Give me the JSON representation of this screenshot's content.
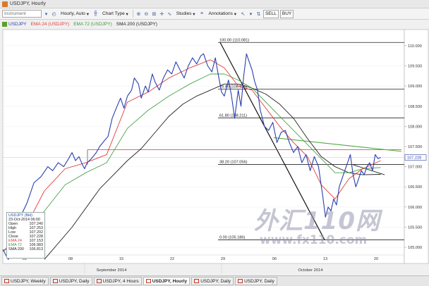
{
  "window": {
    "title": "USDJPY, Hourly"
  },
  "toolbar": {
    "instrument_placeholder": "Instrument",
    "timeframe": "Hourly, Auto",
    "chart_type": "Chart Type",
    "studies": "Studies",
    "annotations": "Annotations",
    "sell": "SELL",
    "buy": "BUY"
  },
  "legend": {
    "symbol": "USDJPY",
    "ema24": "EMA 24 (USDJPY)",
    "ema72": "EMA 72 (USDJPY)",
    "sma200": "SMA 200 (USDJPY)"
  },
  "info": {
    "header": "USDJPY (Bid)",
    "date": "23-Oct-2014 06:00",
    "rows": [
      {
        "k": "Open",
        "v": "107.240"
      },
      {
        "k": "High",
        "v": "107.253"
      },
      {
        "k": "Low",
        "v": "107.202"
      },
      {
        "k": "Close",
        "v": "107.228"
      },
      {
        "k": "EMA 24",
        "v": "107.153"
      },
      {
        "k": "EMA 72",
        "v": "106.983"
      },
      {
        "k": "SMA 200",
        "v": "106.813"
      }
    ]
  },
  "tabs": [
    {
      "label": "USDJPY, Weekly",
      "active": false
    },
    {
      "label": "USDJPY, Daily",
      "active": false
    },
    {
      "label": "USDJPY, 4 Hours",
      "active": false
    },
    {
      "label": "USDJPY, Hourly",
      "active": true
    },
    {
      "label": "USDJPY, Daily",
      "active": false
    },
    {
      "label": "USDJPY, Daily",
      "active": false
    }
  ],
  "watermark": {
    "cn": "外汇110网",
    "url": "www.fx110.com"
  },
  "colors": {
    "price": "#2a3fb0",
    "ema24": "#e23b3b",
    "ema72": "#4aa34a",
    "sma200": "#222222",
    "current": "#e05050",
    "trend": "#55aa44"
  },
  "chart_data": {
    "type": "line",
    "title": "USDJPY, Hourly",
    "ylim": [
      104.6,
      110.4
    ],
    "y_ticks": [
      "110.000",
      "109.500",
      "109.000",
      "108.500",
      "108.000",
      "107.500",
      "107.000",
      "106.500",
      "106.000",
      "105.500",
      "105.000"
    ],
    "y_tick_values": [
      110.0,
      109.5,
      109.0,
      108.5,
      108.0,
      107.5,
      107.0,
      106.5,
      106.0,
      105.5,
      105.0
    ],
    "x_ticks": [
      "01",
      "08",
      "15",
      "22",
      "29",
      "06",
      "13",
      "20"
    ],
    "month_labels": [
      "September 2014",
      "October 2014"
    ],
    "current_price_label": "107.228",
    "fib_levels": [
      {
        "label": "100.00 (110.081)",
        "value": 110.081
      },
      {
        "label": "76.40 (108.926)",
        "value": 108.926
      },
      {
        "label": "61.80 (108.211)",
        "value": 108.211
      },
      {
        "label": "38.20 (107.056)",
        "value": 107.056
      },
      {
        "label": "0.00 (105.186)",
        "value": 105.186
      }
    ],
    "series": [
      {
        "name": "USDJPY",
        "x": [
          0,
          8,
          15,
          20,
          28,
          35,
          45,
          55,
          65,
          72,
          80,
          88,
          95,
          100,
          105,
          110,
          115,
          118,
          122,
          128,
          135,
          140,
          147,
          152,
          158,
          165,
          170,
          175,
          180,
          186,
          190,
          196,
          200,
          206,
          210,
          216,
          220,
          226,
          232,
          238,
          244,
          250,
          256,
          262,
          268,
          274,
          280,
          286,
          290,
          296,
          302,
          307,
          311,
          316,
          320,
          326,
          330,
          335,
          340,
          344,
          348,
          352,
          356,
          360,
          364,
          368,
          372,
          378,
          384,
          390,
          396,
          402,
          408,
          414,
          420,
          426,
          432,
          438,
          444,
          450,
          456,
          462,
          466,
          470,
          474,
          478,
          482,
          486,
          490,
          494,
          498,
          502,
          506,
          510,
          514,
          518,
          522,
          526,
          530,
          534,
          538,
          542,
          546
        ],
        "y": [
          104.95,
          104.7,
          105.15,
          105.35,
          105.85,
          106.1,
          106.6,
          106.75,
          107.0,
          106.9,
          107.1,
          107.0,
          107.2,
          107.35,
          107.15,
          107.25,
          107.05,
          106.95,
          107.1,
          107.2,
          107.35,
          107.5,
          107.65,
          107.75,
          108.2,
          108.5,
          108.7,
          108.45,
          108.75,
          108.9,
          109.2,
          109.05,
          108.7,
          109.0,
          108.85,
          109.3,
          109.1,
          108.9,
          109.2,
          109.4,
          109.3,
          109.6,
          109.4,
          109.2,
          109.5,
          109.7,
          109.55,
          109.75,
          109.8,
          109.5,
          109.35,
          109.7,
          109.3,
          108.85,
          108.75,
          109.15,
          108.8,
          108.2,
          108.9,
          108.5,
          109.25,
          109.8,
          109.6,
          109.4,
          109.1,
          108.9,
          108.4,
          108.0,
          107.9,
          108.1,
          107.6,
          107.85,
          107.9,
          107.6,
          107.35,
          107.5,
          107.1,
          107.3,
          106.9,
          107.25,
          107.0,
          106.3,
          105.75,
          106.0,
          105.9,
          106.2,
          106.05,
          106.5,
          106.7,
          106.9,
          107.1,
          107.3,
          106.8,
          106.5,
          106.7,
          106.9,
          106.8,
          107.0,
          107.1,
          106.9,
          107.3,
          107.2,
          107.23
        ]
      },
      {
        "name": "EMA 24",
        "x": [
          0,
          30,
          60,
          90,
          120,
          150,
          180,
          210,
          240,
          270,
          300,
          320,
          340,
          360,
          380,
          400,
          420,
          440,
          460,
          480,
          500,
          520,
          546
        ],
        "y": [
          104.9,
          105.4,
          106.4,
          106.95,
          107.1,
          107.3,
          108.6,
          108.85,
          109.2,
          109.45,
          109.65,
          109.45,
          109.0,
          108.9,
          108.45,
          108.0,
          107.6,
          107.25,
          106.55,
          106.2,
          106.7,
          106.95,
          107.15
        ]
      },
      {
        "name": "EMA 72",
        "x": [
          0,
          30,
          60,
          90,
          120,
          150,
          180,
          210,
          240,
          270,
          300,
          320,
          340,
          360,
          380,
          400,
          420,
          440,
          460,
          480,
          500,
          520,
          546
        ],
        "y": [
          104.9,
          105.2,
          105.9,
          106.55,
          106.85,
          107.1,
          107.95,
          108.4,
          108.75,
          109.05,
          109.3,
          109.3,
          109.15,
          108.95,
          108.6,
          108.25,
          107.9,
          107.55,
          107.2,
          106.85,
          106.85,
          106.95,
          106.98
        ]
      },
      {
        "name": "SMA 200",
        "x": [
          60,
          100,
          140,
          180,
          200,
          220,
          240,
          260,
          280,
          300,
          320,
          340,
          360,
          380,
          400,
          420,
          440,
          460,
          480,
          500,
          520,
          546
        ],
        "y": [
          104.7,
          105.5,
          106.45,
          107.15,
          107.45,
          107.85,
          108.25,
          108.55,
          108.75,
          108.9,
          109.05,
          109.05,
          108.95,
          108.8,
          108.55,
          108.2,
          107.7,
          107.25,
          107.0,
          106.85,
          106.8,
          106.81
        ]
      }
    ]
  }
}
